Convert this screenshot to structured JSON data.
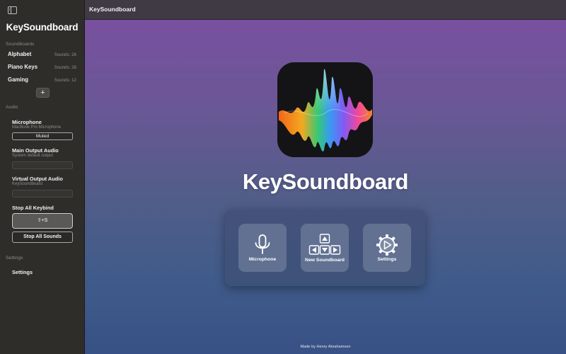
{
  "sidebar": {
    "toggle_icon": "sidebar-toggle-icon",
    "app_title": "KeySoundboard",
    "soundboards_header": "Soundboards",
    "soundboards": [
      {
        "name": "Alphabet",
        "count": "Sounds: 26"
      },
      {
        "name": "Piano Keys",
        "count": "Sounds: 26"
      },
      {
        "name": "Gaming",
        "count": "Sounds: 12"
      }
    ],
    "add_label": "+",
    "audio_header": "Audio",
    "microphone": {
      "title": "Microphone",
      "device": "MacBook Pro Microphone",
      "status": "Muted"
    },
    "main_output": {
      "title": "Main Output Audio",
      "device": "System default output",
      "value": ""
    },
    "virtual_output": {
      "title": "Virtual Output Audio",
      "device": "KeySoundboard",
      "value": ""
    },
    "stop_keybind": {
      "title": "Stop All Keybind",
      "key": "⇧+S"
    },
    "stop_all_label": "Stop All Sounds",
    "settings_header": "Settings",
    "settings_item": "Settings"
  },
  "window": {
    "title": "KeySoundboard"
  },
  "main": {
    "hero_title": "KeySoundboard",
    "tiles": [
      {
        "label": "Microphone",
        "icon": "microphone-icon"
      },
      {
        "label": "New Soundboard",
        "icon": "arrow-keys-icon"
      },
      {
        "label": "Settings",
        "icon": "gear-play-icon"
      }
    ],
    "footer": "Made by Henry Abrahamsen"
  },
  "colors": {
    "sidebar_bg": "#2e2d2a",
    "gradient_top": "#7c4fa1",
    "gradient_bottom": "#385186",
    "tile_bg": "#7d8aa5"
  }
}
